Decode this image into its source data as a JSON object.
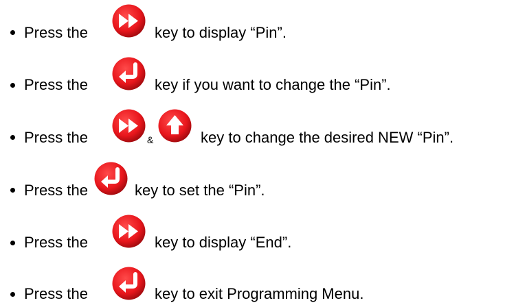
{
  "steps": [
    {
      "prefix": "Press the",
      "suffix": "key to display “Pin”.",
      "icons": [
        "fast-forward"
      ]
    },
    {
      "prefix": "Press the",
      "suffix": "key if you want to change the “Pin”.",
      "icons": [
        "enter-return"
      ]
    },
    {
      "prefix": "Press the",
      "joiner": "&",
      "suffix": "key to change the desired NEW “Pin”.",
      "icons": [
        "fast-forward",
        "up-arrow"
      ]
    },
    {
      "prefix": "Press the",
      "suffix": "key to set the “Pin”.",
      "icons": [
        "enter-return"
      ]
    },
    {
      "prefix": "Press the",
      "suffix": "key to display “End”.",
      "icons": [
        "fast-forward"
      ]
    },
    {
      "prefix": "Press the",
      "suffix": "key to exit Programming Menu.",
      "icons": [
        "enter-return"
      ]
    }
  ],
  "colors": {
    "icon_red": "#e8161c",
    "icon_dark": "#b00f14",
    "icon_glyph": "#ffffff"
  }
}
